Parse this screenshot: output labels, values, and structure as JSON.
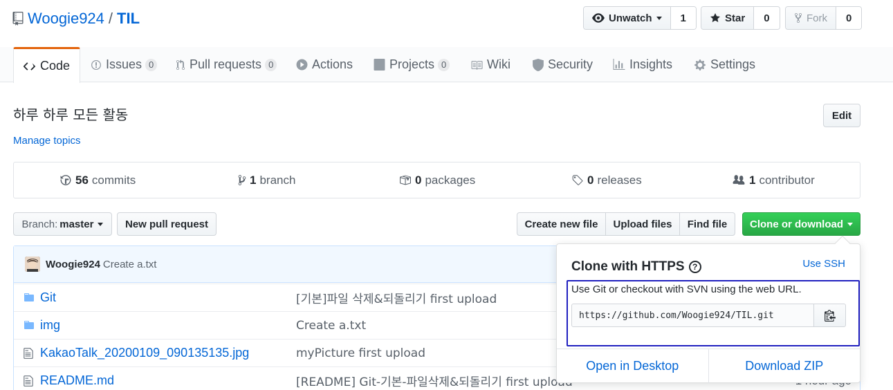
{
  "repo": {
    "owner": "Woogie924",
    "separator": "/",
    "name": "TIL"
  },
  "actions": {
    "watch": {
      "label": "Unwatch",
      "count": "1"
    },
    "star": {
      "label": "Star",
      "count": "0"
    },
    "fork": {
      "label": "Fork",
      "count": "0"
    }
  },
  "tabs": [
    {
      "label": "Code",
      "icon": "code-icon",
      "selected": true
    },
    {
      "label": "Issues",
      "icon": "issue-icon",
      "counter": "0"
    },
    {
      "label": "Pull requests",
      "icon": "pull-request-icon",
      "counter": "0"
    },
    {
      "label": "Actions",
      "icon": "play-icon"
    },
    {
      "label": "Projects",
      "icon": "project-icon",
      "counter": "0"
    },
    {
      "label": "Wiki",
      "icon": "book-icon"
    },
    {
      "label": "Security",
      "icon": "shield-icon"
    },
    {
      "label": "Insights",
      "icon": "graph-icon"
    },
    {
      "label": "Settings",
      "icon": "gear-icon"
    }
  ],
  "description": "하루 하루 모든 활동",
  "manage_topics": "Manage topics",
  "edit_label": "Edit",
  "summary": [
    {
      "count": "56",
      "label": "commits",
      "icon": "history-icon"
    },
    {
      "count": "1",
      "label": "branch",
      "icon": "branch-icon"
    },
    {
      "count": "0",
      "label": "packages",
      "icon": "package-icon"
    },
    {
      "count": "0",
      "label": "releases",
      "icon": "tag-icon"
    },
    {
      "count": "1",
      "label": "contributor",
      "icon": "people-icon"
    }
  ],
  "filenav": {
    "branch_prefix": "Branch:",
    "branch": "master",
    "new_pr": "New pull request",
    "create_file": "Create new file",
    "upload_files": "Upload files",
    "find_file": "Find file",
    "clone": "Clone or download"
  },
  "last_commit": {
    "author": "Woogie924",
    "message": "Create a.txt"
  },
  "files": [
    {
      "name": "Git",
      "type": "dir",
      "message": "[기본]파일 삭제&되돌리기 first upload"
    },
    {
      "name": "img",
      "type": "dir",
      "message": "Create a.txt"
    },
    {
      "name": "KakaoTalk_20200109_090135135.jpg",
      "type": "file",
      "message": "myPicture first upload"
    },
    {
      "name": "README.md",
      "type": "file",
      "message": "[README] Git-기본-파일삭제&되돌리기 first upload",
      "age": "1 hour ago"
    }
  ],
  "clone": {
    "title": "Clone with HTTPS",
    "use_ssh": "Use SSH",
    "note": "Use Git or checkout with SVN using the web URL.",
    "url": "https://github.com/Woogie924/TIL.git",
    "open_desktop": "Open in Desktop",
    "download_zip": "Download ZIP"
  },
  "colors": {
    "accent_tab": "#e36209",
    "link": "#0366d6",
    "green": "#28a745",
    "highlight_box": "#1f1fbf"
  }
}
